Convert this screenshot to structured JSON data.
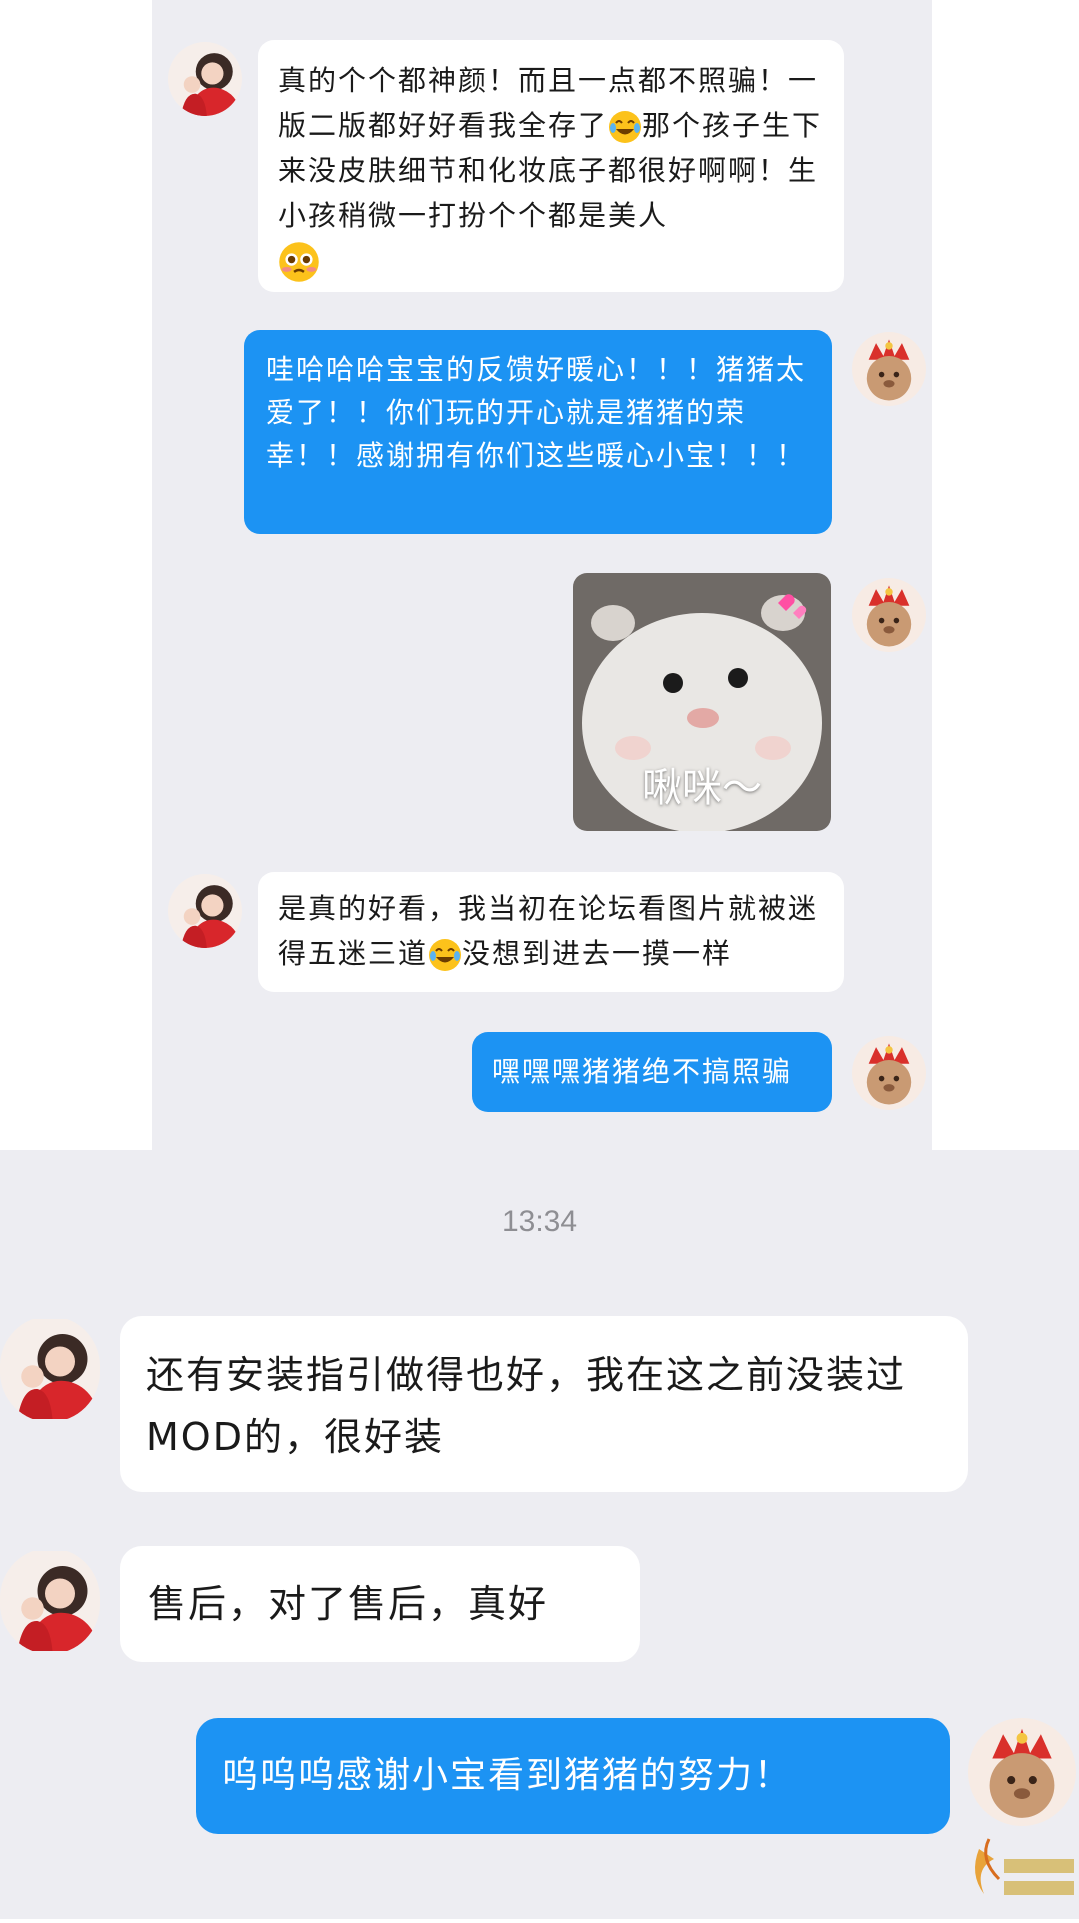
{
  "chat": {
    "timestamp": "13:34",
    "messages": [
      {
        "sender": "customer",
        "text": "真的个个都神颜！而且一点都不照骗！一版二版都好好看我全存了",
        "emoji_1": "laugh-cry-emoji",
        "text_2": "那个孩子生下来没皮肤细节和化妆底子都很好啊啊！生小孩稍微一打扮个个都是美人",
        "emoji_2": "pleading-emoji"
      },
      {
        "sender": "shop",
        "text": "哇哈哈哈宝宝的反馈好暖心！！！猪猪太爱了！！你们玩的开心就是猪猪的荣幸！！感谢拥有你们这些暖心小宝！！！"
      },
      {
        "sender": "shop",
        "type": "sticker",
        "caption": "啾咪～"
      },
      {
        "sender": "customer",
        "text": "是真的好看，我当初在论坛看图片就被迷得五迷三道",
        "emoji_1": "laugh-cry-emoji",
        "text_2": "没想到进去一摸一样"
      },
      {
        "sender": "shop",
        "text": "嘿嘿嘿猪猪绝不搞照骗"
      },
      {
        "sender": "customer",
        "text": "还有安装指引做得也好，我在这之前没装过MOD的，很好装"
      },
      {
        "sender": "customer",
        "text": "售后，对了售后，真好"
      },
      {
        "sender": "shop",
        "text": "呜呜呜感谢小宝看到猪猪的努力！"
      }
    ]
  },
  "colors": {
    "background": "#ededf2",
    "incoming_bubble": "#ffffff",
    "outgoing_bubble": "#1c93f3"
  }
}
